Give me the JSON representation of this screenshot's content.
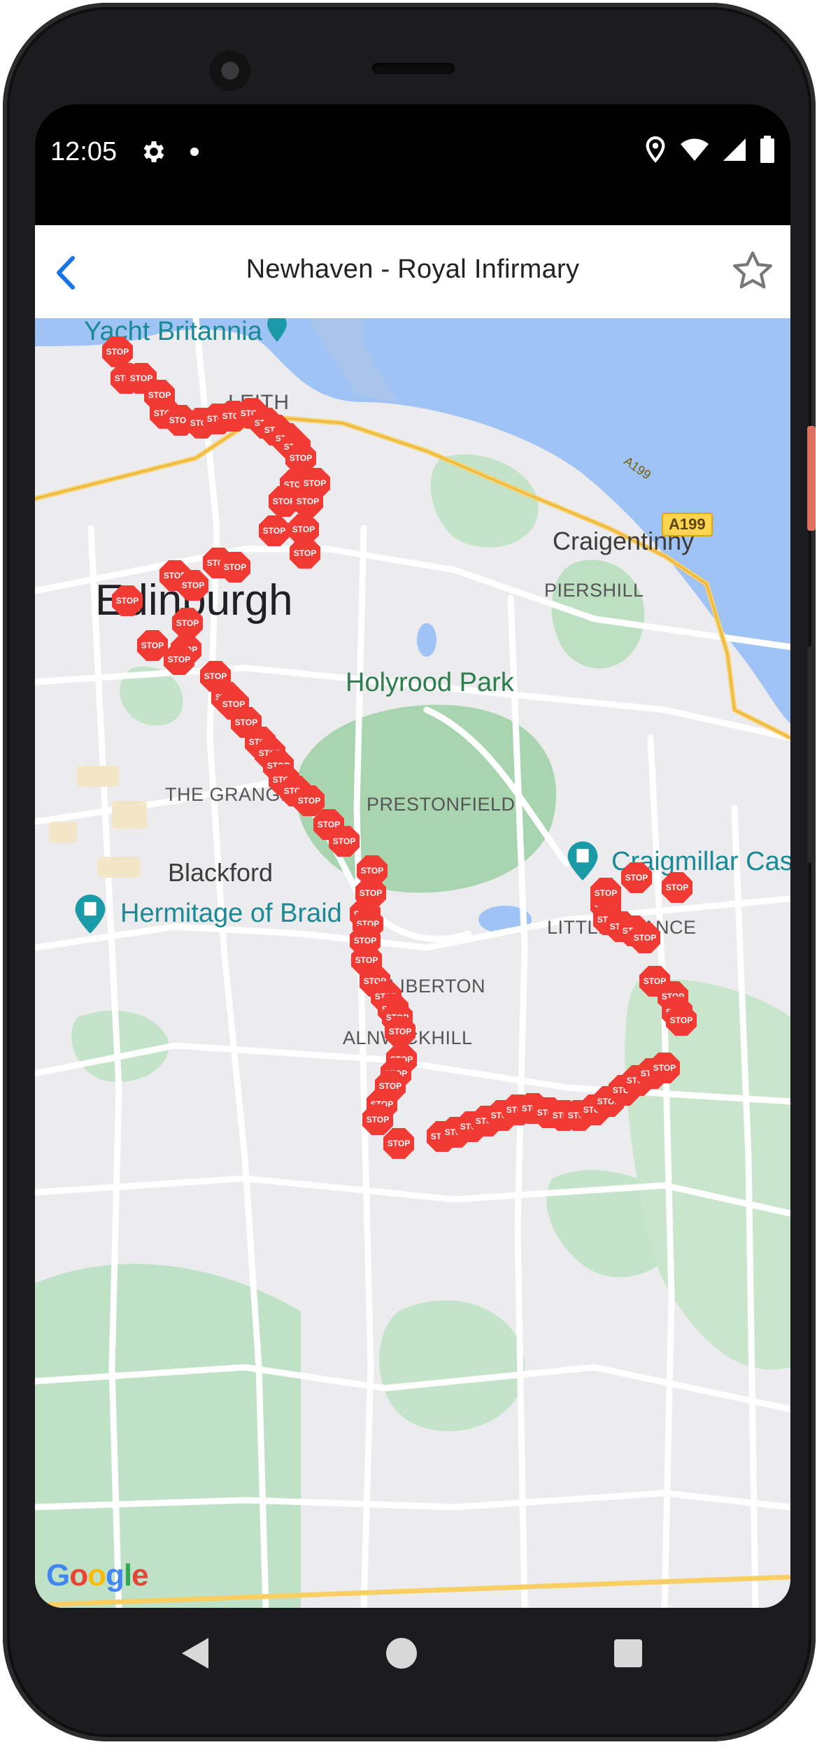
{
  "status_bar": {
    "time": "12:05",
    "icons": [
      "settings-gear-icon",
      "notification-dot-icon",
      "location-icon",
      "wifi-icon",
      "signal-icon",
      "battery-icon"
    ]
  },
  "app_bar": {
    "title": "Newhaven - Royal Infirmary",
    "back_icon": "chevron-left-icon",
    "favorite_icon": "star-outline-icon",
    "accent_color": "#1a73e8"
  },
  "map": {
    "labels": {
      "yacht_britannia": "Yacht Britannia",
      "leith": "LEITH",
      "craigentinny": "Craigentinny",
      "piershill": "PIERSHILL",
      "edinburgh": "Edinburgh",
      "holyrood_park": "Holyrood Park",
      "the_grange": "THE GRANGE",
      "prestonfield": "PRESTONFIELD",
      "craigmillar": "Craigmillar Cas",
      "blackford": "Blackford",
      "hermitage": "Hermitage of Braid",
      "little_france": "LITTLE FRANCE",
      "liberton": "LIBERTON",
      "alnwickhill": "ALNWICKHILL",
      "a199_a": "A199",
      "a199_b": "A199"
    },
    "marker_label": "STOP",
    "marker_color": "#f03a33",
    "attribution": "Google"
  },
  "nav_bar": {
    "back_icon": "nav-back-triangle-icon",
    "home_icon": "nav-home-circle-icon",
    "recents_icon": "nav-recents-square-icon"
  }
}
